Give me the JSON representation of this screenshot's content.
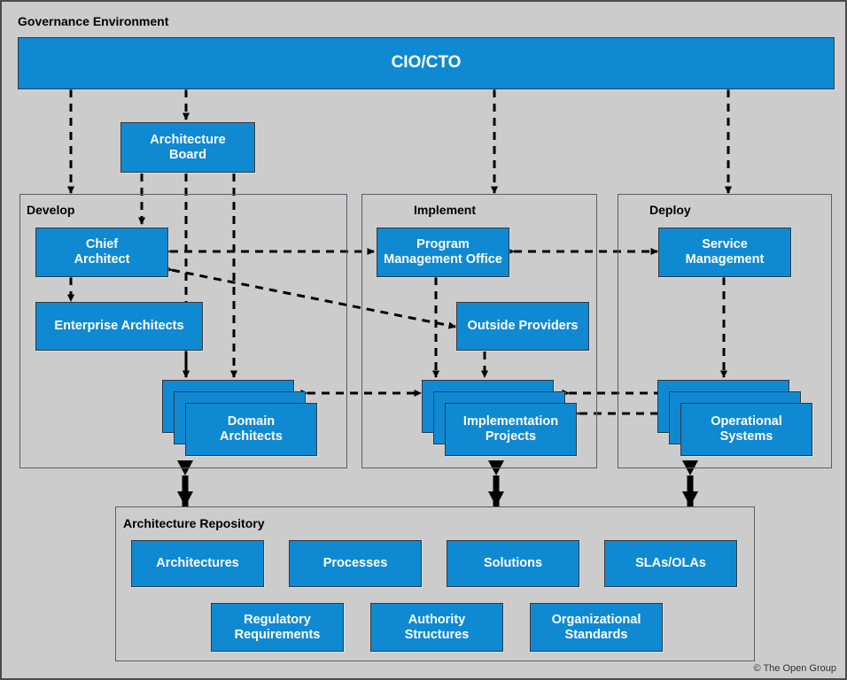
{
  "diagram": {
    "title": "Governance Environment",
    "copyright": "© The Open Group",
    "colors": {
      "box_fill": "#1089d3",
      "box_border": "#33383d",
      "background": "#cccccc",
      "panel_border": "#5c5f63",
      "outer_border": "#4b4b4b",
      "line": "#000000",
      "text_on_box": "#ffffff"
    }
  },
  "top": {
    "cio_cto": "CIO/CTO",
    "architecture_board": "Architecture\nBoard"
  },
  "panels": [
    {
      "id": "develop",
      "title": "Develop",
      "boxes": [
        {
          "id": "chief-architect",
          "label": "Chief\nArchitect"
        },
        {
          "id": "enterprise-architects",
          "label": "Enterprise Architects"
        },
        {
          "id": "domain-architects",
          "label": "Domain\nArchitects",
          "stacked": true
        }
      ]
    },
    {
      "id": "implement",
      "title": "Implement",
      "boxes": [
        {
          "id": "program-management-office",
          "label": "Program\nManagement Office"
        },
        {
          "id": "outside-providers",
          "label": "Outside Providers"
        },
        {
          "id": "implementation-projects",
          "label": "Implementation\nProjects",
          "stacked": true
        }
      ]
    },
    {
      "id": "deploy",
      "title": "Deploy",
      "boxes": [
        {
          "id": "service-management",
          "label": "Service\nManagement"
        },
        {
          "id": "operational-systems",
          "label": "Operational\nSystems",
          "stacked": true
        }
      ]
    }
  ],
  "repository": {
    "title": "Architecture Repository",
    "row1": [
      "Architectures",
      "Processes",
      "Solutions",
      "SLAs/OLAs"
    ],
    "row2": [
      "Regulatory\nRequirements",
      "Authority\nStructures",
      "Organizational\nStandards"
    ]
  }
}
